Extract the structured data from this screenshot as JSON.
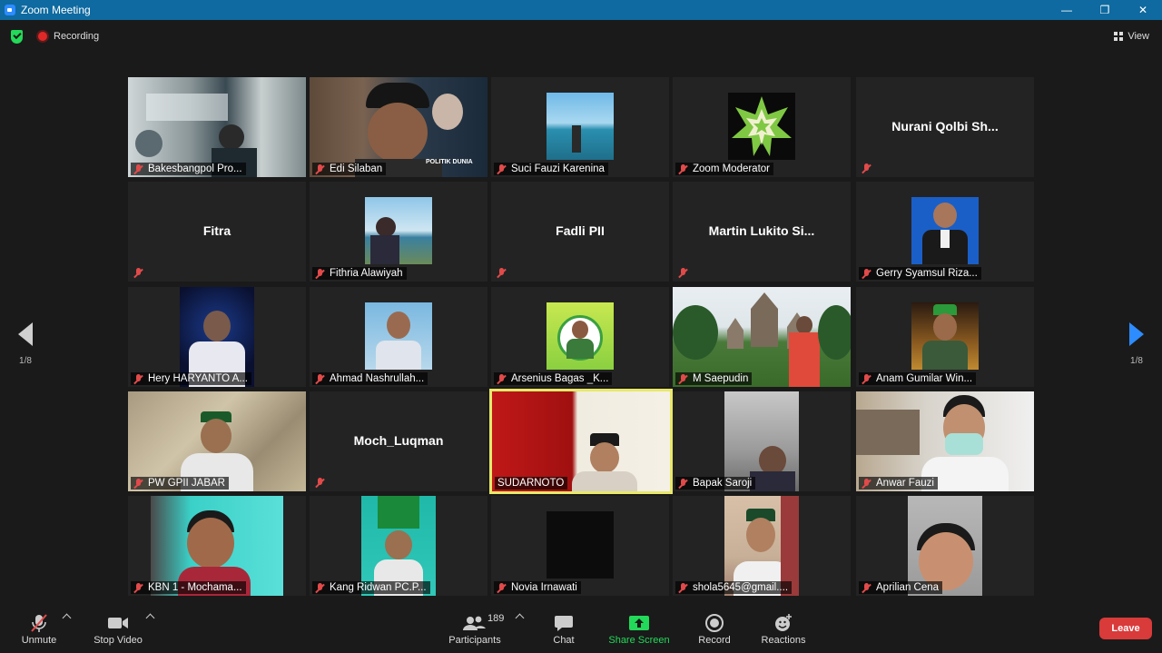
{
  "window": {
    "title": "Zoom Meeting",
    "minimize": "—",
    "restore": "❐",
    "close": "✕"
  },
  "status": {
    "recording_label": "Recording",
    "view_label": "View"
  },
  "pagination": {
    "left_page": "1/8",
    "right_page": "1/8"
  },
  "tiles": [
    {
      "name": "Bakesbangpol Pro...",
      "show_big": false
    },
    {
      "name": "Edi Silaban",
      "show_big": false
    },
    {
      "name": "Suci Fauzi Karenina",
      "show_big": false
    },
    {
      "name": "Zoom Moderator",
      "show_big": false
    },
    {
      "name": "Nurani  Qolbi  Sh...",
      "show_big": true
    },
    {
      "name": "Fitra",
      "show_big": true
    },
    {
      "name": "Fithria Alawiyah",
      "show_big": false
    },
    {
      "name": "Fadli PII",
      "show_big": true
    },
    {
      "name": "Martin  Lukito  Si...",
      "show_big": true
    },
    {
      "name": "Gerry Syamsul Riza...",
      "show_big": false
    },
    {
      "name": "Hery HARYANTO A...",
      "show_big": false
    },
    {
      "name": "Ahmad Nashrullah...",
      "show_big": false
    },
    {
      "name": "Arsenius Bagas _K...",
      "show_big": false
    },
    {
      "name": "M Saepudin",
      "show_big": false
    },
    {
      "name": "Anam Gumilar Win...",
      "show_big": false
    },
    {
      "name": "PW GPII JABAR",
      "show_big": false
    },
    {
      "name": "Moch_Luqman",
      "show_big": true
    },
    {
      "name": "SUDARNOTO",
      "show_big": false
    },
    {
      "name": "Bapak Saroji",
      "show_big": false
    },
    {
      "name": "Anwar Fauzi",
      "show_big": false
    },
    {
      "name": "KBN 1 - Mochama...",
      "show_big": false
    },
    {
      "name": "Kang Ridwan PC.P...",
      "show_big": false
    },
    {
      "name": "Novia Irnawati",
      "show_big": false
    },
    {
      "name": "shola5645@gmail....",
      "show_big": false
    },
    {
      "name": "Aprilian Cena",
      "show_big": false
    }
  ],
  "toolbar": {
    "unmute": "Unmute",
    "stop_video": "Stop Video",
    "participants_count": "189",
    "participants": "Participants",
    "chat": "Chat",
    "share_screen": "Share Screen",
    "record": "Record",
    "reactions": "Reactions",
    "leave": "Leave"
  },
  "colors": {
    "accent": "#2d8cff",
    "share_green": "#23d959",
    "leave_red": "#d93a3a",
    "active_border": "#e8e86a"
  }
}
